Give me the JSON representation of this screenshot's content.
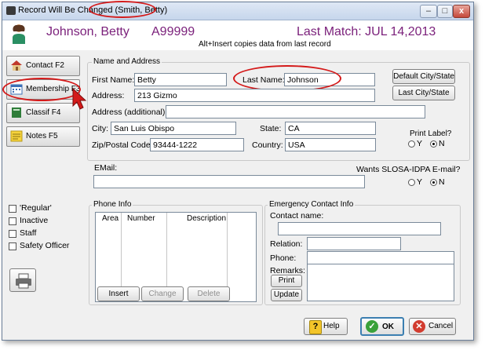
{
  "window": {
    "title_prefix": "Record Will Be Changed",
    "title_name": "(Smith, Betty)",
    "min_label": "–",
    "max_label": "□",
    "close_label": "x"
  },
  "header": {
    "name": "Johnson, Betty",
    "id": "A99999",
    "last_match": "Last Match: JUL 14,2013",
    "note": "Alt+Insert copies data from last record"
  },
  "sidebar": {
    "buttons": [
      {
        "label": "Contact  F2",
        "icon": "house-icon"
      },
      {
        "label": "Membership F3",
        "icon": "calendar-icon"
      },
      {
        "label": "Classif  F4",
        "icon": "book-icon"
      },
      {
        "label": "Notes     F5",
        "icon": "sticky-note-icon"
      }
    ],
    "checkboxes": [
      "'Regular'",
      "Inactive",
      "Staff",
      "Safety Officer"
    ],
    "print_icon": "printer-icon"
  },
  "name_address": {
    "group_label": "Name and Address",
    "first_name_label": "First Name:",
    "first_name": "Betty",
    "last_name_label": "Last Name:",
    "last_name": "Johnson",
    "address_label": "Address:",
    "address": "213 Gizmo",
    "address2_label": "Address (additional):",
    "address2": "",
    "city_label": "City:",
    "city": "San Luis Obispo",
    "state_label": "State:",
    "state": "CA",
    "zip_label": "Zip/Postal Code:",
    "zip": "93444-1222",
    "country_label": "Country:",
    "country": "USA",
    "default_city_btn": "Default City/State",
    "last_city_btn": "Last City/State",
    "print_label": "Print Label?",
    "radio_y": "Y",
    "radio_n": "N"
  },
  "email": {
    "label": "EMail:",
    "value": "",
    "wants_label": "Wants SLOSA-IDPA E-mail?",
    "radio_y": "Y",
    "radio_n": "N"
  },
  "phone": {
    "group_label": "Phone Info",
    "columns": [
      "Area",
      "Number",
      "Description"
    ],
    "insert_btn": "Insert",
    "change_btn": "Change",
    "delete_btn": "Delete"
  },
  "emergency": {
    "group_label": "Emergency Contact Info",
    "contact_name_label": "Contact name:",
    "relation_label": "Relation:",
    "phone_label": "Phone:",
    "remarks_label": "Remarks:",
    "print_btn": "Print",
    "update_btn": "Update"
  },
  "footer": {
    "help_btn": "Help",
    "ok_btn": "OK",
    "cancel_btn": "Cancel"
  }
}
